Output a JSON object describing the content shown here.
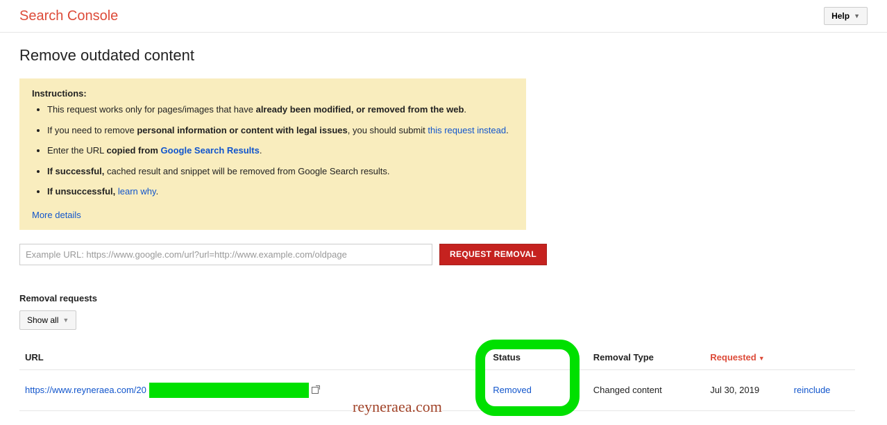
{
  "header": {
    "brand": "Search Console",
    "help_label": "Help"
  },
  "page": {
    "title": "Remove outdated content"
  },
  "instructions": {
    "title": "Instructions:",
    "items": [
      {
        "prefix": "This request works only for pages/images that have ",
        "bold": "already been modified, or removed from the web",
        "suffix": "."
      },
      {
        "prefix": "If you need to remove ",
        "bold": "personal information or content with legal issues",
        "suffix": ", you should submit ",
        "link": "this request instead",
        "tail": "."
      },
      {
        "prefix": "Enter the URL ",
        "bold": "copied from ",
        "linkbold": "Google Search Results",
        "suffix": "."
      },
      {
        "prefixbold": "If successful,",
        "suffix": " cached result and snippet will be removed from Google Search results."
      },
      {
        "prefixbold": "If unsuccessful,",
        "suffix": " ",
        "link": "learn why",
        "tail": "."
      }
    ],
    "more_details": "More details"
  },
  "url_form": {
    "placeholder": "Example URL: https://www.google.com/url?url=http://www.example.com/oldpage",
    "button": "REQUEST REMOVAL"
  },
  "requests": {
    "section_title": "Removal requests",
    "filter_label": "Show all",
    "columns": {
      "url": "URL",
      "status": "Status",
      "type": "Removal Type",
      "requested": "Requested"
    },
    "rows": [
      {
        "url_prefix": "https://www.reyneraea.com/20",
        "status": "Removed",
        "type": "Changed content",
        "requested": "Jul 30, 2019",
        "action": "reinclude"
      }
    ]
  },
  "watermark": "reyneraea.com"
}
